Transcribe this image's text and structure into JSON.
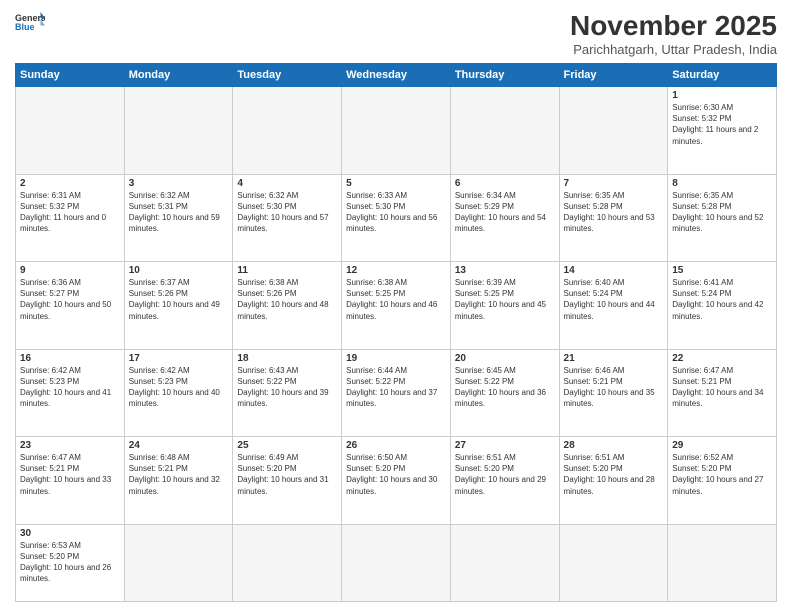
{
  "header": {
    "logo_general": "General",
    "logo_blue": "Blue",
    "month_title": "November 2025",
    "location": "Parichhatgarh, Uttar Pradesh, India"
  },
  "days_of_week": [
    "Sunday",
    "Monday",
    "Tuesday",
    "Wednesday",
    "Thursday",
    "Friday",
    "Saturday"
  ],
  "weeks": [
    [
      {
        "day": "",
        "empty": true
      },
      {
        "day": "",
        "empty": true
      },
      {
        "day": "",
        "empty": true
      },
      {
        "day": "",
        "empty": true
      },
      {
        "day": "",
        "empty": true
      },
      {
        "day": "",
        "empty": true
      },
      {
        "day": "1",
        "sunrise": "6:30 AM",
        "sunset": "5:32 PM",
        "daylight": "11 hours and 2 minutes."
      }
    ],
    [
      {
        "day": "2",
        "sunrise": "6:31 AM",
        "sunset": "5:32 PM",
        "daylight": "11 hours and 0 minutes."
      },
      {
        "day": "3",
        "sunrise": "6:32 AM",
        "sunset": "5:31 PM",
        "daylight": "10 hours and 59 minutes."
      },
      {
        "day": "4",
        "sunrise": "6:32 AM",
        "sunset": "5:30 PM",
        "daylight": "10 hours and 57 minutes."
      },
      {
        "day": "5",
        "sunrise": "6:33 AM",
        "sunset": "5:30 PM",
        "daylight": "10 hours and 56 minutes."
      },
      {
        "day": "6",
        "sunrise": "6:34 AM",
        "sunset": "5:29 PM",
        "daylight": "10 hours and 54 minutes."
      },
      {
        "day": "7",
        "sunrise": "6:35 AM",
        "sunset": "5:28 PM",
        "daylight": "10 hours and 53 minutes."
      },
      {
        "day": "8",
        "sunrise": "6:35 AM",
        "sunset": "5:28 PM",
        "daylight": "10 hours and 52 minutes."
      }
    ],
    [
      {
        "day": "9",
        "sunrise": "6:36 AM",
        "sunset": "5:27 PM",
        "daylight": "10 hours and 50 minutes."
      },
      {
        "day": "10",
        "sunrise": "6:37 AM",
        "sunset": "5:26 PM",
        "daylight": "10 hours and 49 minutes."
      },
      {
        "day": "11",
        "sunrise": "6:38 AM",
        "sunset": "5:26 PM",
        "daylight": "10 hours and 48 minutes."
      },
      {
        "day": "12",
        "sunrise": "6:38 AM",
        "sunset": "5:25 PM",
        "daylight": "10 hours and 46 minutes."
      },
      {
        "day": "13",
        "sunrise": "6:39 AM",
        "sunset": "5:25 PM",
        "daylight": "10 hours and 45 minutes."
      },
      {
        "day": "14",
        "sunrise": "6:40 AM",
        "sunset": "5:24 PM",
        "daylight": "10 hours and 44 minutes."
      },
      {
        "day": "15",
        "sunrise": "6:41 AM",
        "sunset": "5:24 PM",
        "daylight": "10 hours and 42 minutes."
      }
    ],
    [
      {
        "day": "16",
        "sunrise": "6:42 AM",
        "sunset": "5:23 PM",
        "daylight": "10 hours and 41 minutes."
      },
      {
        "day": "17",
        "sunrise": "6:42 AM",
        "sunset": "5:23 PM",
        "daylight": "10 hours and 40 minutes."
      },
      {
        "day": "18",
        "sunrise": "6:43 AM",
        "sunset": "5:22 PM",
        "daylight": "10 hours and 39 minutes."
      },
      {
        "day": "19",
        "sunrise": "6:44 AM",
        "sunset": "5:22 PM",
        "daylight": "10 hours and 37 minutes."
      },
      {
        "day": "20",
        "sunrise": "6:45 AM",
        "sunset": "5:22 PM",
        "daylight": "10 hours and 36 minutes."
      },
      {
        "day": "21",
        "sunrise": "6:46 AM",
        "sunset": "5:21 PM",
        "daylight": "10 hours and 35 minutes."
      },
      {
        "day": "22",
        "sunrise": "6:47 AM",
        "sunset": "5:21 PM",
        "daylight": "10 hours and 34 minutes."
      }
    ],
    [
      {
        "day": "23",
        "sunrise": "6:47 AM",
        "sunset": "5:21 PM",
        "daylight": "10 hours and 33 minutes."
      },
      {
        "day": "24",
        "sunrise": "6:48 AM",
        "sunset": "5:21 PM",
        "daylight": "10 hours and 32 minutes."
      },
      {
        "day": "25",
        "sunrise": "6:49 AM",
        "sunset": "5:20 PM",
        "daylight": "10 hours and 31 minutes."
      },
      {
        "day": "26",
        "sunrise": "6:50 AM",
        "sunset": "5:20 PM",
        "daylight": "10 hours and 30 minutes."
      },
      {
        "day": "27",
        "sunrise": "6:51 AM",
        "sunset": "5:20 PM",
        "daylight": "10 hours and 29 minutes."
      },
      {
        "day": "28",
        "sunrise": "6:51 AM",
        "sunset": "5:20 PM",
        "daylight": "10 hours and 28 minutes."
      },
      {
        "day": "29",
        "sunrise": "6:52 AM",
        "sunset": "5:20 PM",
        "daylight": "10 hours and 27 minutes."
      }
    ],
    [
      {
        "day": "30",
        "sunrise": "6:53 AM",
        "sunset": "5:20 PM",
        "daylight": "10 hours and 26 minutes."
      },
      {
        "day": "",
        "empty": true
      },
      {
        "day": "",
        "empty": true
      },
      {
        "day": "",
        "empty": true
      },
      {
        "day": "",
        "empty": true
      },
      {
        "day": "",
        "empty": true
      },
      {
        "day": "",
        "empty": true
      }
    ]
  ]
}
